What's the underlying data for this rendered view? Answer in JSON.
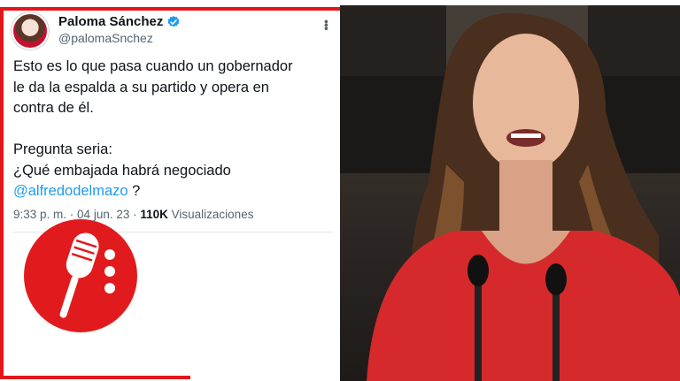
{
  "tweet": {
    "display_name": "Paloma Sánchez",
    "handle": "@palomaSnchez",
    "verified": true,
    "more_icon": "more-vertical-icon",
    "text_line1": "Esto es lo que pasa cuando un gobernador",
    "text_line2": "le da la espalda a su partido y opera en",
    "text_line3": "contra de él.",
    "text_line4": "Pregunta seria:",
    "text_line5": "¿Qué embajada habrá negociado",
    "mention": "@alfredodelmazo",
    "text_end": " ?",
    "time": "9:33 p. m.",
    "separator": " · ",
    "date": "04 jun. 23",
    "views_count": "110K",
    "views_label": " Visualizaciones"
  },
  "colors": {
    "accent_red": "#e4161b",
    "link_blue": "#1d9bf0",
    "verified_blue": "#1d9bf0",
    "logo_red": "#e11b1d"
  },
  "logo": {
    "icon": "microphone-icon"
  },
  "photo": {
    "subject": "woman-speaking-at-podium-photo"
  }
}
